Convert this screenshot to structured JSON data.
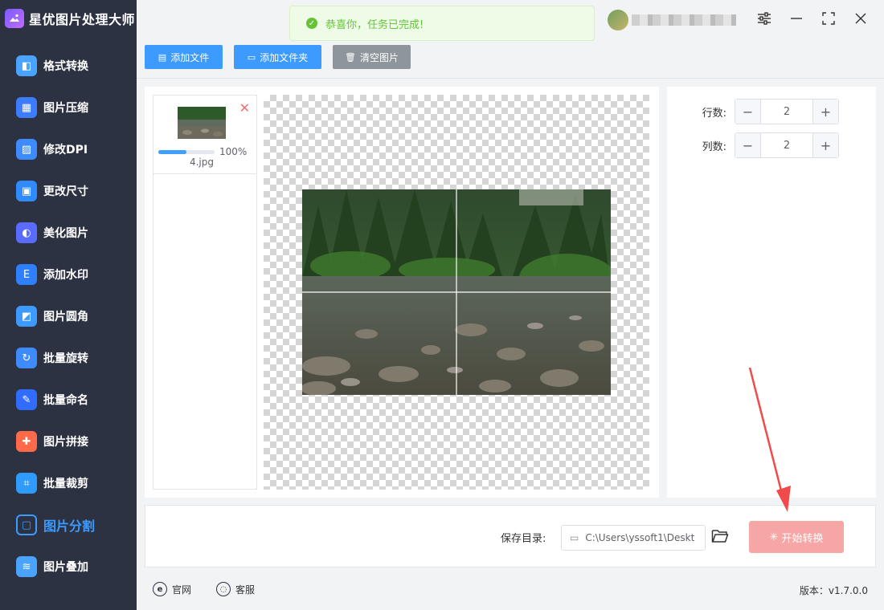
{
  "app": {
    "title": "星优图片处理大师"
  },
  "sidebar": {
    "items": [
      {
        "label": "格式转换",
        "icon": "format-convert-icon",
        "color": "#4aa3ff"
      },
      {
        "label": "图片压缩",
        "icon": "compress-icon",
        "color": "#3d7bff"
      },
      {
        "label": "修改DPI",
        "icon": "dpi-icon",
        "color": "#3d8bff"
      },
      {
        "label": "更改尺寸",
        "icon": "resize-icon",
        "color": "#2f8bff"
      },
      {
        "label": "美化图片",
        "icon": "beautify-icon",
        "color": "#5a6cff"
      },
      {
        "label": "添加水印",
        "icon": "watermark-icon",
        "color": "#2f80ff"
      },
      {
        "label": "图片圆角",
        "icon": "round-corner-icon",
        "color": "#3d9bff"
      },
      {
        "label": "批量旋转",
        "icon": "rotate-icon",
        "color": "#3d8bff"
      },
      {
        "label": "批量命名",
        "icon": "rename-icon",
        "color": "#2f6cff"
      },
      {
        "label": "图片拼接",
        "icon": "puzzle-icon",
        "color": "#ff6b4a"
      },
      {
        "label": "批量裁剪",
        "icon": "crop-icon",
        "color": "#2f9bff"
      },
      {
        "label": "图片分割",
        "icon": "split-icon",
        "color": "#3b9bff",
        "active": true
      },
      {
        "label": "图片叠加",
        "icon": "layers-icon",
        "color": "#4aa3ff"
      }
    ]
  },
  "toast": {
    "message": "恭喜你，任务已完成!"
  },
  "toolbar": {
    "add_file": "添加文件",
    "add_folder": "添加文件夹",
    "clear": "清空图片"
  },
  "files": [
    {
      "name": "4.jpg",
      "progress_text": "100%",
      "progress": 1.0
    }
  ],
  "settings": {
    "rows_label": "行数:",
    "rows_value": "2",
    "cols_label": "列数:",
    "cols_value": "2"
  },
  "save": {
    "label": "保存目录:",
    "path": "C:\\Users\\yssoft1\\Deskt"
  },
  "start_button": "开始转换",
  "footer": {
    "website": "官网",
    "support": "客服",
    "version": "版本：v1.7.0.0"
  },
  "colors": {
    "sidebar_bg": "#2c3242",
    "accent": "#3d9bff",
    "start_button": "#f7a6a6",
    "toast_text": "#67c23a"
  }
}
